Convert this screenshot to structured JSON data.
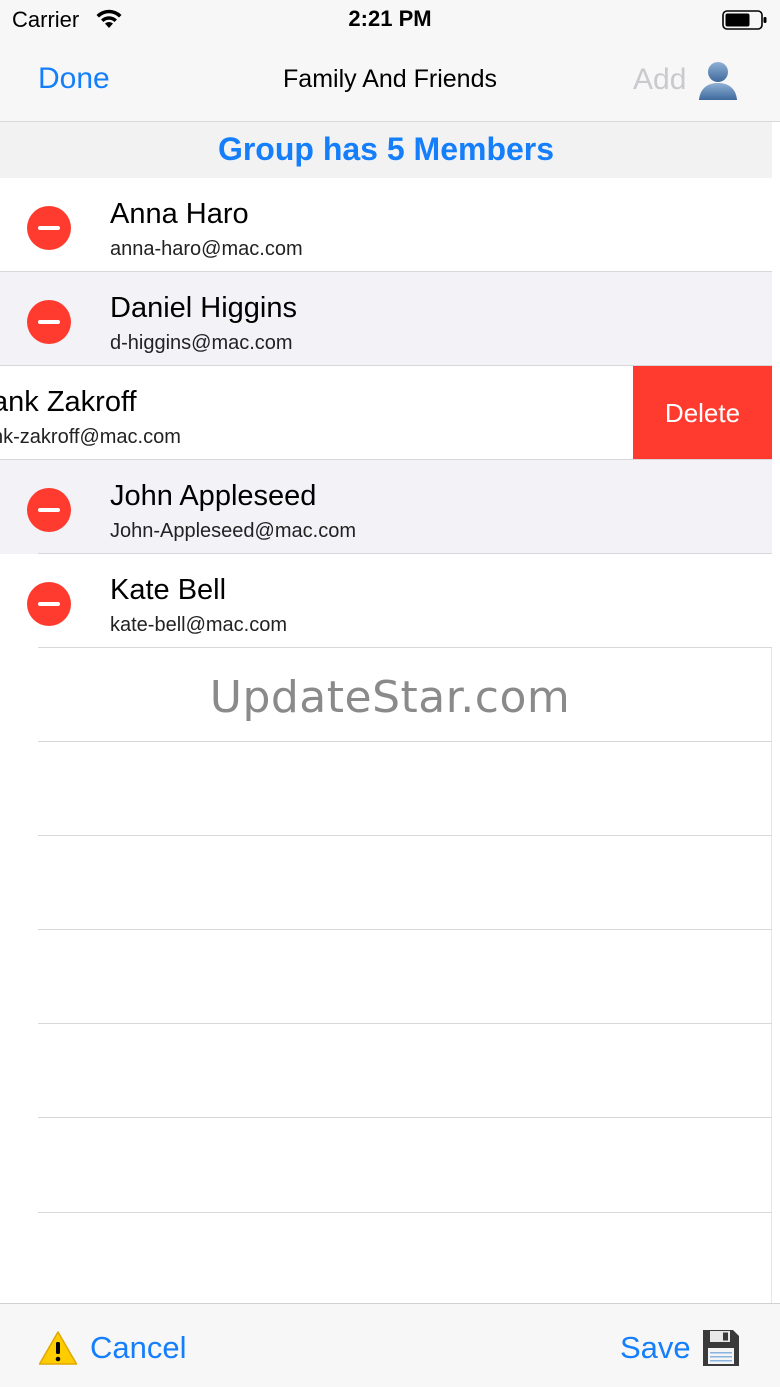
{
  "status_bar": {
    "carrier": "Carrier",
    "time": "2:21 PM"
  },
  "nav": {
    "done_label": "Done",
    "title": "Family And Friends",
    "add_label": "Add"
  },
  "group": {
    "header": "Group has 5 Members"
  },
  "members": [
    {
      "name": "Anna Haro",
      "email": "anna-haro@mac.com"
    },
    {
      "name": "Daniel Higgins",
      "email": "d-higgins@mac.com"
    },
    {
      "name": "ank Zakroff",
      "email": "nk-zakroff@mac.com"
    },
    {
      "name": "John Appleseed",
      "email": "John-Appleseed@mac.com"
    },
    {
      "name": "Kate Bell",
      "email": "kate-bell@mac.com"
    }
  ],
  "delete_label": "Delete",
  "watermark": "UpdateStar.com",
  "toolbar": {
    "cancel_label": "Cancel",
    "save_label": "Save"
  },
  "colors": {
    "accent": "#147efb",
    "destructive": "#ff3b30",
    "disabled": "#c9c9ce"
  },
  "icons": {
    "wifi": "wifi-icon",
    "battery": "battery-icon",
    "person": "person-icon",
    "minus": "minus-circle-icon",
    "warning": "warning-icon",
    "save": "floppy-disk-icon"
  }
}
